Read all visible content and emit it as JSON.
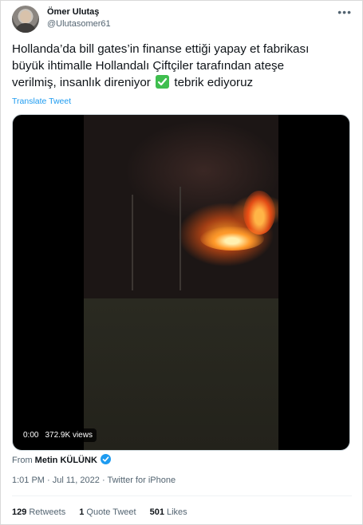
{
  "author": {
    "name": "Ömer Ulutaş",
    "handle": "@Ulutasomer61"
  },
  "menu_icon": "more-horizontal-icon",
  "tweet": {
    "line1": "Hollanda’da bill gates’in finanse ettiği yapay et fabrikası",
    "line2": "büyük ihtimalle Hollandalı Çiftçiler tarafından ateşe",
    "line3a": "verilmiş, insanlık direniyor",
    "line3b": "tebrik ediyoruz",
    "emoji": "check-mark-button-icon",
    "translate_label": "Translate Tweet"
  },
  "media": {
    "time": "0:00",
    "views": "372.9K views"
  },
  "from": {
    "prefix": "From",
    "name": "Metin KÜLÜNK"
  },
  "meta": {
    "time": "1:01 PM",
    "sep1": "·",
    "date": "Jul 11, 2022",
    "sep2": "·",
    "client": "Twitter for iPhone"
  },
  "stats": {
    "retweets_count": "129",
    "retweets_label": "Retweets",
    "quotes_count": "1",
    "quotes_label": "Quote Tweet",
    "likes_count": "501",
    "likes_label": "Likes"
  },
  "colors": {
    "link": "#1d9bf0",
    "secondary_text": "#536471",
    "check_green": "#3fbe4f"
  }
}
